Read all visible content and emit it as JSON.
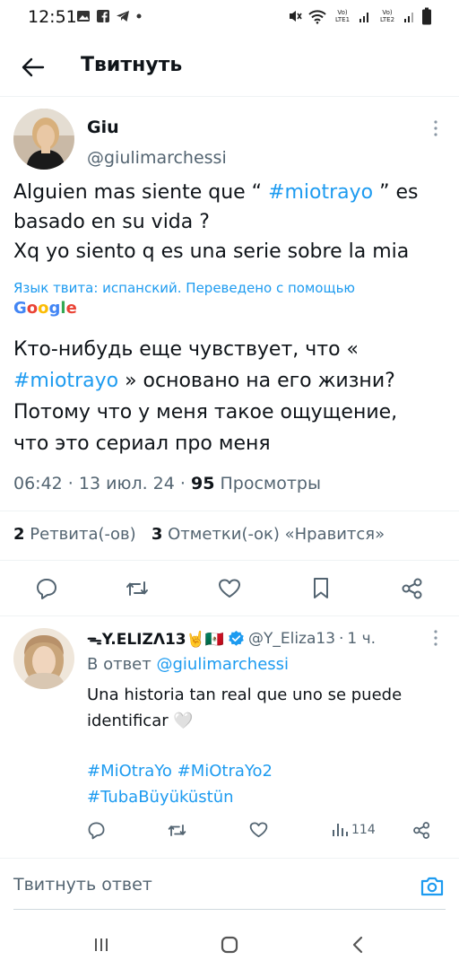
{
  "status_bar": {
    "time": "12:51",
    "sim1_label": "Vo) LTE1",
    "sim2_label": "Vo) LTE2",
    "icons": [
      "gallery-icon",
      "facebook-icon",
      "telegram-icon",
      "dot-icon",
      "mute-icon",
      "wifi-icon",
      "signal-icon",
      "battery-icon"
    ]
  },
  "header": {
    "title": "Твитнуть"
  },
  "tweet": {
    "author_name": "Giu",
    "author_handle": "@giulimarchessi",
    "text_line1_a": "Alguien mas siente que “ ",
    "text_line1_hashtag": "#miotrayo",
    "text_line1_b": " ” es",
    "text_line2": "basado en su vida ?",
    "text_line3": "Xq yo siento q es una serie sobre la mia",
    "translation_note": "Язык твита: испанский. Переведено с помощью",
    "translator": "Google",
    "translated_line1": "Кто-нибудь еще чувствует, что «",
    "translated_hashtag": "#miotrayo",
    "translated_line2_rest": " » основано на его жизни?",
    "translated_line3": "Потому что у меня такое ощущение,",
    "translated_line4": "что это сериал про меня",
    "time": "06:42",
    "date": "13 июл. 24",
    "views_count": "95",
    "views_label": "Просмотры",
    "retweets_count": "2",
    "retweets_label": "Ретвита(-ов)",
    "likes_count": "3",
    "likes_label": "Отметки(-ок) «Нравится»"
  },
  "reply": {
    "author_name": "ᯓY.ELIZΛ13🤘🇲🇽",
    "author_handle": "@Y_Eliza13",
    "age": "1 ч.",
    "reply_to_prefix": "В ответ",
    "reply_to_handle": "@giulimarchessi",
    "text_line1": "Una historia tan real que uno se puede",
    "text_line2": "identificar 🤍",
    "hashtag_line1": "#MiOtraYo #MiOtraYo2",
    "hashtag_line2": "#TubaBüyüküstün",
    "views": "114"
  },
  "composer": {
    "placeholder": "Твитнуть ответ"
  },
  "colors": {
    "accent": "#1d9bf0",
    "text": "#0f1419",
    "muted": "#536471",
    "verified": "#1d9bf0"
  }
}
